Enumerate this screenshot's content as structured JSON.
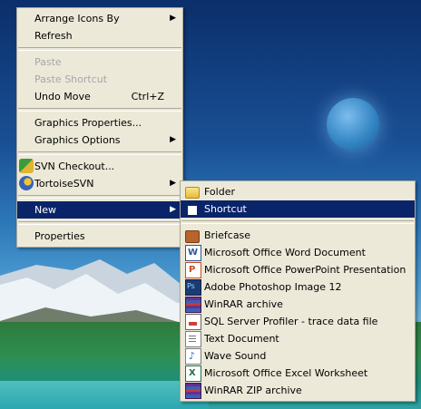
{
  "context_menu": {
    "items": [
      {
        "label": "Arrange Icons By",
        "submenu": true
      },
      {
        "label": "Refresh"
      },
      {
        "label": "Paste",
        "disabled": true
      },
      {
        "label": "Paste Shortcut",
        "disabled": true
      },
      {
        "label": "Undo Move",
        "shortcut": "Ctrl+Z"
      },
      {
        "label": "Graphics Properties..."
      },
      {
        "label": "Graphics Options",
        "submenu": true
      },
      {
        "label": "SVN Checkout...",
        "icon": "svn-checkout-icon"
      },
      {
        "label": "TortoiseSVN",
        "submenu": true,
        "icon": "tortoisesvn-icon"
      },
      {
        "label": "New",
        "submenu": true,
        "highlighted": true
      },
      {
        "label": "Properties"
      }
    ]
  },
  "new_submenu": {
    "items": [
      {
        "label": "Folder",
        "icon": "folder-icon"
      },
      {
        "label": "Shortcut",
        "icon": "shortcut-icon",
        "highlighted": true
      },
      {
        "label": "Briefcase",
        "icon": "briefcase-icon"
      },
      {
        "label": "Microsoft Office Word Document",
        "icon": "word-doc-icon"
      },
      {
        "label": "Microsoft Office PowerPoint Presentation",
        "icon": "powerpoint-icon"
      },
      {
        "label": "Adobe Photoshop Image 12",
        "icon": "photoshop-icon"
      },
      {
        "label": "WinRAR archive",
        "icon": "winrar-icon"
      },
      {
        "label": "SQL Server Profiler - trace data file",
        "icon": "sql-profiler-icon"
      },
      {
        "label": "Text Document",
        "icon": "text-document-icon"
      },
      {
        "label": "Wave Sound",
        "icon": "wave-sound-icon"
      },
      {
        "label": "Microsoft Office Excel Worksheet",
        "icon": "excel-icon"
      },
      {
        "label": "WinRAR ZIP archive",
        "icon": "winrar-zip-icon"
      }
    ]
  },
  "colors": {
    "menu_bg": "#ece9d8",
    "highlight": "#0a246a",
    "disabled_text": "#a7a6aa"
  }
}
